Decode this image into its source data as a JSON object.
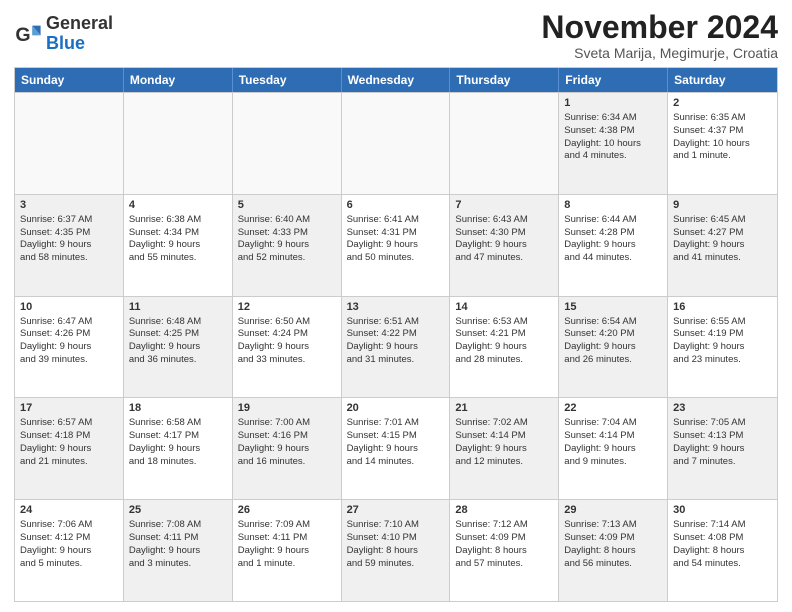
{
  "logo": {
    "general": "General",
    "blue": "Blue"
  },
  "header": {
    "title": "November 2024",
    "subtitle": "Sveta Marija, Megimurje, Croatia"
  },
  "days": [
    "Sunday",
    "Monday",
    "Tuesday",
    "Wednesday",
    "Thursday",
    "Friday",
    "Saturday"
  ],
  "rows": [
    [
      {
        "day": "",
        "empty": true
      },
      {
        "day": "",
        "empty": true
      },
      {
        "day": "",
        "empty": true
      },
      {
        "day": "",
        "empty": true
      },
      {
        "day": "",
        "empty": true
      },
      {
        "day": "1",
        "shaded": true,
        "lines": [
          "Sunrise: 6:34 AM",
          "Sunset: 4:38 PM",
          "Daylight: 10 hours",
          "and 4 minutes."
        ]
      },
      {
        "day": "2",
        "lines": [
          "Sunrise: 6:35 AM",
          "Sunset: 4:37 PM",
          "Daylight: 10 hours",
          "and 1 minute."
        ]
      }
    ],
    [
      {
        "day": "3",
        "shaded": true,
        "lines": [
          "Sunrise: 6:37 AM",
          "Sunset: 4:35 PM",
          "Daylight: 9 hours",
          "and 58 minutes."
        ]
      },
      {
        "day": "4",
        "lines": [
          "Sunrise: 6:38 AM",
          "Sunset: 4:34 PM",
          "Daylight: 9 hours",
          "and 55 minutes."
        ]
      },
      {
        "day": "5",
        "shaded": true,
        "lines": [
          "Sunrise: 6:40 AM",
          "Sunset: 4:33 PM",
          "Daylight: 9 hours",
          "and 52 minutes."
        ]
      },
      {
        "day": "6",
        "lines": [
          "Sunrise: 6:41 AM",
          "Sunset: 4:31 PM",
          "Daylight: 9 hours",
          "and 50 minutes."
        ]
      },
      {
        "day": "7",
        "shaded": true,
        "lines": [
          "Sunrise: 6:43 AM",
          "Sunset: 4:30 PM",
          "Daylight: 9 hours",
          "and 47 minutes."
        ]
      },
      {
        "day": "8",
        "lines": [
          "Sunrise: 6:44 AM",
          "Sunset: 4:28 PM",
          "Daylight: 9 hours",
          "and 44 minutes."
        ]
      },
      {
        "day": "9",
        "shaded": true,
        "lines": [
          "Sunrise: 6:45 AM",
          "Sunset: 4:27 PM",
          "Daylight: 9 hours",
          "and 41 minutes."
        ]
      }
    ],
    [
      {
        "day": "10",
        "lines": [
          "Sunrise: 6:47 AM",
          "Sunset: 4:26 PM",
          "Daylight: 9 hours",
          "and 39 minutes."
        ]
      },
      {
        "day": "11",
        "shaded": true,
        "lines": [
          "Sunrise: 6:48 AM",
          "Sunset: 4:25 PM",
          "Daylight: 9 hours",
          "and 36 minutes."
        ]
      },
      {
        "day": "12",
        "lines": [
          "Sunrise: 6:50 AM",
          "Sunset: 4:24 PM",
          "Daylight: 9 hours",
          "and 33 minutes."
        ]
      },
      {
        "day": "13",
        "shaded": true,
        "lines": [
          "Sunrise: 6:51 AM",
          "Sunset: 4:22 PM",
          "Daylight: 9 hours",
          "and 31 minutes."
        ]
      },
      {
        "day": "14",
        "lines": [
          "Sunrise: 6:53 AM",
          "Sunset: 4:21 PM",
          "Daylight: 9 hours",
          "and 28 minutes."
        ]
      },
      {
        "day": "15",
        "shaded": true,
        "lines": [
          "Sunrise: 6:54 AM",
          "Sunset: 4:20 PM",
          "Daylight: 9 hours",
          "and 26 minutes."
        ]
      },
      {
        "day": "16",
        "lines": [
          "Sunrise: 6:55 AM",
          "Sunset: 4:19 PM",
          "Daylight: 9 hours",
          "and 23 minutes."
        ]
      }
    ],
    [
      {
        "day": "17",
        "shaded": true,
        "lines": [
          "Sunrise: 6:57 AM",
          "Sunset: 4:18 PM",
          "Daylight: 9 hours",
          "and 21 minutes."
        ]
      },
      {
        "day": "18",
        "lines": [
          "Sunrise: 6:58 AM",
          "Sunset: 4:17 PM",
          "Daylight: 9 hours",
          "and 18 minutes."
        ]
      },
      {
        "day": "19",
        "shaded": true,
        "lines": [
          "Sunrise: 7:00 AM",
          "Sunset: 4:16 PM",
          "Daylight: 9 hours",
          "and 16 minutes."
        ]
      },
      {
        "day": "20",
        "lines": [
          "Sunrise: 7:01 AM",
          "Sunset: 4:15 PM",
          "Daylight: 9 hours",
          "and 14 minutes."
        ]
      },
      {
        "day": "21",
        "shaded": true,
        "lines": [
          "Sunrise: 7:02 AM",
          "Sunset: 4:14 PM",
          "Daylight: 9 hours",
          "and 12 minutes."
        ]
      },
      {
        "day": "22",
        "lines": [
          "Sunrise: 7:04 AM",
          "Sunset: 4:14 PM",
          "Daylight: 9 hours",
          "and 9 minutes."
        ]
      },
      {
        "day": "23",
        "shaded": true,
        "lines": [
          "Sunrise: 7:05 AM",
          "Sunset: 4:13 PM",
          "Daylight: 9 hours",
          "and 7 minutes."
        ]
      }
    ],
    [
      {
        "day": "24",
        "lines": [
          "Sunrise: 7:06 AM",
          "Sunset: 4:12 PM",
          "Daylight: 9 hours",
          "and 5 minutes."
        ]
      },
      {
        "day": "25",
        "shaded": true,
        "lines": [
          "Sunrise: 7:08 AM",
          "Sunset: 4:11 PM",
          "Daylight: 9 hours",
          "and 3 minutes."
        ]
      },
      {
        "day": "26",
        "lines": [
          "Sunrise: 7:09 AM",
          "Sunset: 4:11 PM",
          "Daylight: 9 hours",
          "and 1 minute."
        ]
      },
      {
        "day": "27",
        "shaded": true,
        "lines": [
          "Sunrise: 7:10 AM",
          "Sunset: 4:10 PM",
          "Daylight: 8 hours",
          "and 59 minutes."
        ]
      },
      {
        "day": "28",
        "lines": [
          "Sunrise: 7:12 AM",
          "Sunset: 4:09 PM",
          "Daylight: 8 hours",
          "and 57 minutes."
        ]
      },
      {
        "day": "29",
        "shaded": true,
        "lines": [
          "Sunrise: 7:13 AM",
          "Sunset: 4:09 PM",
          "Daylight: 8 hours",
          "and 56 minutes."
        ]
      },
      {
        "day": "30",
        "lines": [
          "Sunrise: 7:14 AM",
          "Sunset: 4:08 PM",
          "Daylight: 8 hours",
          "and 54 minutes."
        ]
      }
    ]
  ]
}
